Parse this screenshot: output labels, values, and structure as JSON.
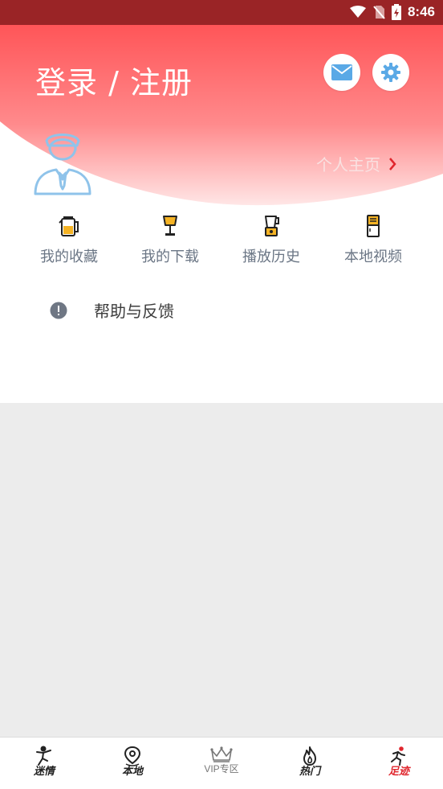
{
  "status_bar": {
    "time": "8:46"
  },
  "header": {
    "title": "登录 / 注册",
    "profile_link": "个人主页"
  },
  "quick_actions": [
    {
      "label": "我的收藏",
      "icon": "kettle-icon"
    },
    {
      "label": "我的下载",
      "icon": "lamp-icon"
    },
    {
      "label": "播放历史",
      "icon": "blender-icon"
    },
    {
      "label": "本地视频",
      "icon": "fridge-icon"
    }
  ],
  "help": {
    "label": "帮助与反馈",
    "icon": "info-icon"
  },
  "bottom_nav": [
    {
      "label": "迷情",
      "icon": "dancer-icon",
      "active": false
    },
    {
      "label": "本地",
      "icon": "location-pin-icon",
      "active": false
    },
    {
      "label": "VIP专区",
      "icon": "crown-icon",
      "active": false
    },
    {
      "label": "热门",
      "icon": "flame-icon",
      "active": false
    },
    {
      "label": "足迹",
      "icon": "runner-icon",
      "active": true
    }
  ],
  "colors": {
    "status_bar": "#9a2426",
    "header_gradient_top": "#ff5a5f",
    "active": "#e0262d",
    "icon_accent": "#f5b324"
  }
}
